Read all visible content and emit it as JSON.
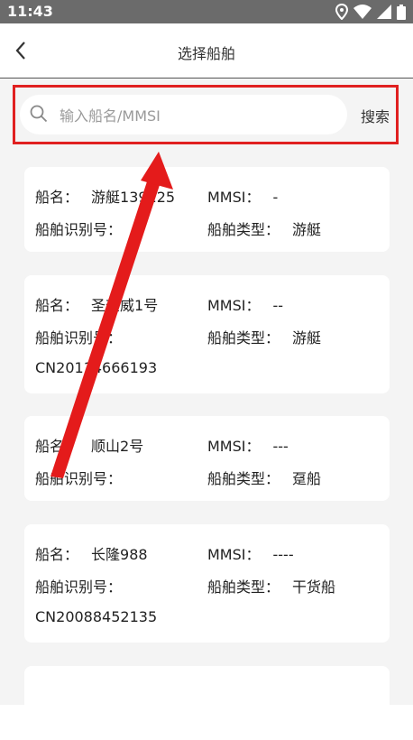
{
  "status": {
    "time": "11:43"
  },
  "header": {
    "title": "选择船舶"
  },
  "search": {
    "placeholder": "输入船名/MMSI",
    "value": "",
    "button_label": "搜索"
  },
  "labels": {
    "name": "船名：",
    "mmsi": "MMSI：",
    "ship_id": "船舶识别号：",
    "ship_type": "船舶类型："
  },
  "ships": [
    {
      "name": "游艇139125",
      "mmsi": "-",
      "ship_id": "",
      "ship_type": "游艇"
    },
    {
      "name": "圣奎威1号",
      "mmsi": "--",
      "ship_id": "CN20114666193",
      "ship_type": "游艇"
    },
    {
      "name": "顺山2号",
      "mmsi": "---",
      "ship_id": "",
      "ship_type": "趸船"
    },
    {
      "name": "长隆988",
      "mmsi": "----",
      "ship_id": "CN20088452135",
      "ship_type": "干货船"
    }
  ],
  "colors": {
    "highlight": "#e02020",
    "status_bar": "#6b6b6b",
    "list_bg": "#f4f4f4"
  }
}
